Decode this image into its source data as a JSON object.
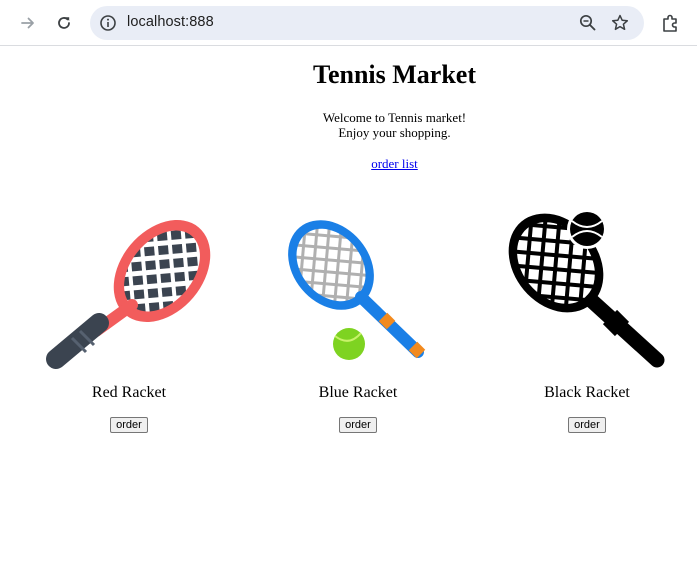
{
  "browser": {
    "url": "localhost:888",
    "icons": [
      "arrow-forward-icon",
      "reload-icon",
      "info-icon",
      "zoom-icon",
      "star-icon",
      "extensions-icon"
    ]
  },
  "page": {
    "title": "Tennis Market",
    "welcome_line1": "Welcome to Tennis market!",
    "welcome_line2": "Enjoy your shopping.",
    "order_list_link": "order list"
  },
  "products": [
    {
      "name": "Red Racket",
      "button": "order",
      "color": "#f25c5c",
      "icon": "red-racket-icon"
    },
    {
      "name": "Blue Racket",
      "button": "order",
      "color": "#1a7fe6",
      "icon": "blue-racket-icon"
    },
    {
      "name": "Black Racket",
      "button": "order",
      "color": "#000000",
      "icon": "black-racket-icon"
    }
  ]
}
